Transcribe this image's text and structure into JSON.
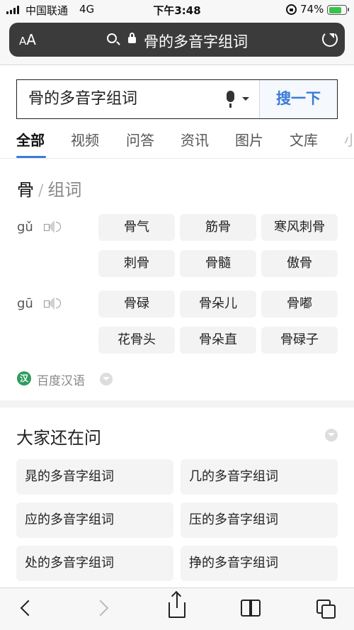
{
  "status_bar": {
    "carrier": "中国联通",
    "network": "4G",
    "time": "下午3:48",
    "battery": "74%",
    "battery_level": 0.74
  },
  "address_bar": {
    "text_size_label_big": "A",
    "text_size_label_small": "A",
    "url_text": "骨的多音字组词"
  },
  "search": {
    "query": "骨的多音字组词",
    "button_label": "搜一下"
  },
  "tabs": [
    {
      "label": "全部",
      "active": true
    },
    {
      "label": "视频"
    },
    {
      "label": "问答"
    },
    {
      "label": "资讯"
    },
    {
      "label": "图片"
    },
    {
      "label": "文库"
    },
    {
      "label": "小"
    }
  ],
  "dictionary": {
    "char": "骨",
    "separator": "/",
    "subtitle": "组词",
    "readings": [
      {
        "pinyin": "gǔ",
        "words": [
          "骨气",
          "筋骨",
          "寒风刺骨",
          "刺骨",
          "骨髓",
          "傲骨"
        ]
      },
      {
        "pinyin": "gū",
        "words": [
          "骨碌",
          "骨朵儿",
          "骨嘟",
          "花骨头",
          "骨朵直",
          "骨碌子"
        ]
      }
    ],
    "source_logo": "汉",
    "source_label": "百度汉语"
  },
  "related": {
    "title": "大家还在问",
    "items": [
      "晁的多音字组词",
      "几的多音字组词",
      "应的多音字组词",
      "压的多音字组词",
      "处的多音字组词",
      "挣的多音字组词"
    ]
  },
  "icons": {
    "back": "chevron-left-icon",
    "forward": "chevron-right-icon",
    "share": "share-icon",
    "bookmarks": "book-icon",
    "tabs": "tabs-icon"
  },
  "colors": {
    "accent": "#3a7bd5",
    "battery": "#3bc24a",
    "source_logo": "#2e9b5e"
  }
}
